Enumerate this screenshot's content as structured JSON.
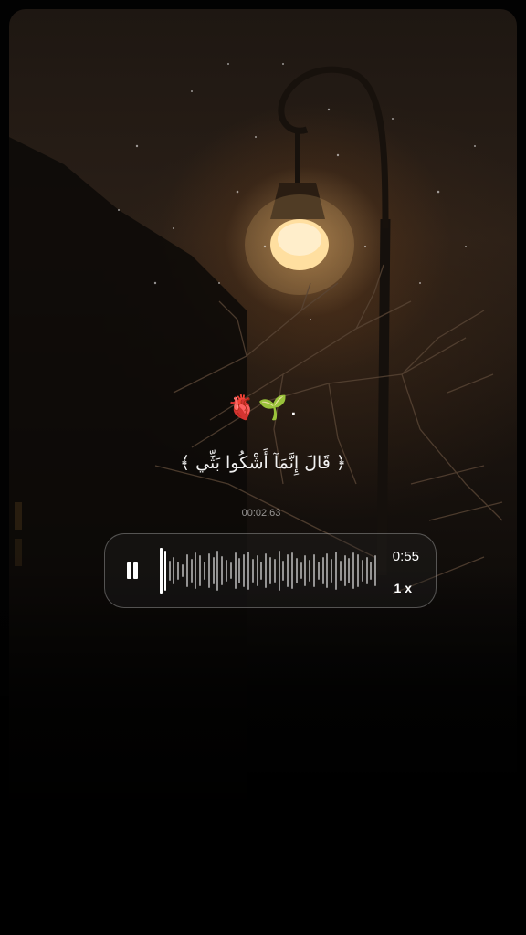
{
  "caption": {
    "emojis": "🫀🌱.",
    "verse": "﴿ قَالَ إِنَّمَآ أَشْكُوا بَثِّي ﴾"
  },
  "player": {
    "elapsed": "00:02.63",
    "duration": "0:55",
    "speed": "1 x",
    "pause_icon": "pause-icon",
    "progress_fraction": 0.03
  },
  "colors": {
    "background": "#020202",
    "text": "#ffffff",
    "lamp_glow": "#ffd89a"
  }
}
